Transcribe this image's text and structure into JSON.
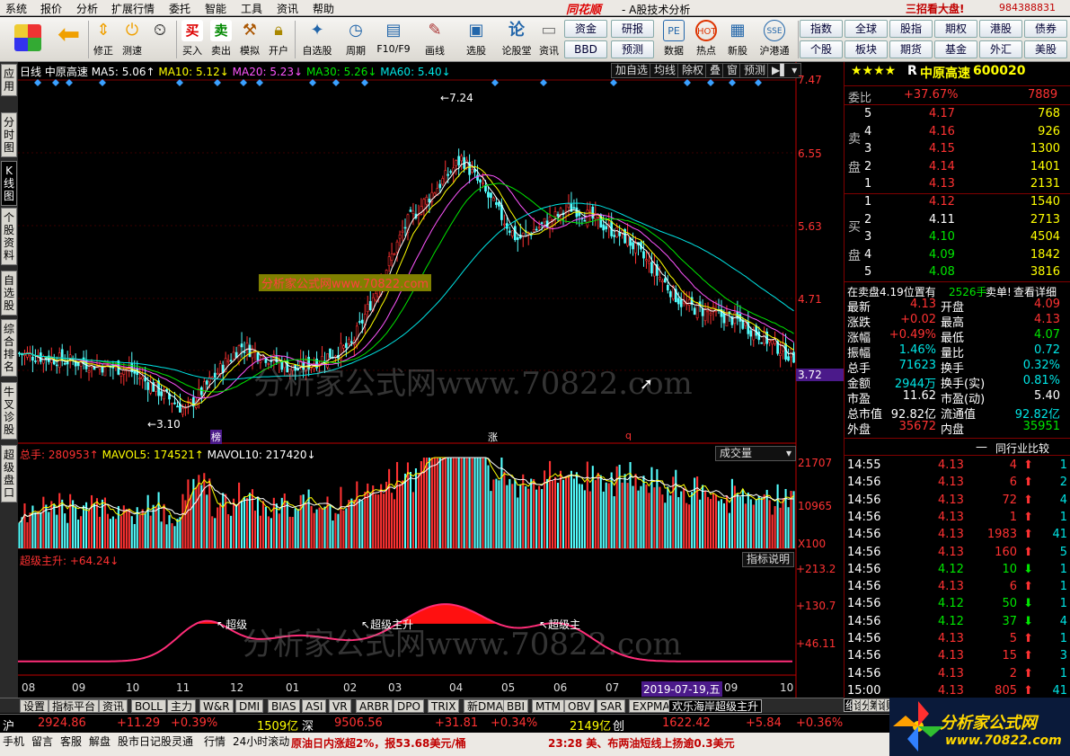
{
  "menu": {
    "items": [
      "系统",
      "报价",
      "分析",
      "扩展行情",
      "委托",
      "智能",
      "工具",
      "资讯",
      "帮助"
    ],
    "brand": "同花顺",
    "subtitle": "- A股技术分析",
    "ad": "三招看大盘!",
    "account": "984388831"
  },
  "toolbar": {
    "buttons": [
      "修正",
      "测速",
      "买入",
      "卖出",
      "模拟",
      "开户",
      "自选股",
      "周期",
      "F10/F9",
      "画线",
      "选股",
      "论股堂",
      "资讯",
      "数据",
      "热点",
      "新股",
      "沪港通"
    ],
    "quick": [
      "资金",
      "研报",
      "BBD",
      "预测",
      "指数",
      "全球",
      "股指",
      "期权",
      "港股",
      "债券",
      "个股",
      "板块",
      "期货",
      "基金",
      "外汇",
      "美股"
    ]
  },
  "lefttabs": [
    "应用",
    "分时图",
    "K线图",
    "个股资料",
    "自选股",
    "综合排名",
    "牛叉诊股",
    "超级盘口"
  ],
  "chart": {
    "price_legend": {
      "period": "日线",
      "name": "中原高速",
      "ma5": "MA5: 5.06↑",
      "ma10": "MA10: 5.12↓",
      "ma20": "MA20: 5.23↓",
      "ma30": "MA30: 5.26↓",
      "ma60": "MA60: 5.40↓"
    },
    "chart_buttons": [
      "加自选",
      "均线",
      "除权",
      "叠",
      "窗",
      "预测"
    ],
    "price_axis": [
      "7.47",
      "6.55",
      "5.63",
      "4.71",
      "3.72"
    ],
    "high_label": "7.24",
    "low_label": "3.10",
    "watermark_small": "分析家公式网www.70822.com",
    "watermark_big": "分析家公式网www.70822.com",
    "marks": [
      "榜",
      "涨",
      "q"
    ],
    "vol_legend": {
      "total": "总手: 280953↑",
      "mavol5": "MAVOL5: 174521↑",
      "mavol10": "MAVOL10: 217420↓"
    },
    "vol_button": "成交量",
    "vol_axis": [
      "21707",
      "10965"
    ],
    "vol_unit": "X100",
    "ind_legend": "超级主升: +64.24↓",
    "ind_button": "指标说明",
    "ind_axis": [
      "+213.2",
      "+130.7",
      "+46.11"
    ],
    "ind_marks": [
      "超级",
      "超级主升",
      "超级主"
    ],
    "x_labels": [
      "08",
      "09",
      "10",
      "11",
      "12",
      "01",
      "02",
      "03",
      "04",
      "05",
      "06",
      "07",
      "08",
      "09",
      "10"
    ],
    "date_label": "2019-07-19,五"
  },
  "chart_data": {
    "type": "candlestick",
    "title": "",
    "xlabel": "",
    "ylabel": "",
    "ylim": [
      3.72,
      7.47
    ],
    "high": 7.24,
    "low": 3.1,
    "x": [
      "08",
      "09",
      "10",
      "11",
      "12",
      "01",
      "02",
      "03",
      "04",
      "05",
      "06",
      "07",
      "08",
      "09",
      "10"
    ],
    "close_approx": [
      4.2,
      4.1,
      4.0,
      3.5,
      4.3,
      4.0,
      4.3,
      5.8,
      6.6,
      5.6,
      6.0,
      5.6,
      4.8,
      4.6,
      4.15
    ]
  },
  "quote": {
    "stars": "★★★★",
    "code_prefix": "R",
    "name": "中原高速",
    "code": "600020",
    "weibi_label": "委比",
    "weibi": "+37.67%",
    "weicha": "7889",
    "sell_label": "卖盘",
    "buy_label": "买盘",
    "sells": [
      {
        "n": "5",
        "p": "4.17",
        "v": "768"
      },
      {
        "n": "4",
        "p": "4.16",
        "v": "926"
      },
      {
        "n": "3",
        "p": "4.15",
        "v": "1300"
      },
      {
        "n": "2",
        "p": "4.14",
        "v": "1401"
      },
      {
        "n": "1",
        "p": "4.13",
        "v": "2131"
      }
    ],
    "buys": [
      {
        "n": "1",
        "p": "4.12",
        "v": "1540"
      },
      {
        "n": "2",
        "p": "4.11",
        "v": "2713"
      },
      {
        "n": "3",
        "p": "4.10",
        "v": "4504"
      },
      {
        "n": "4",
        "p": "4.09",
        "v": "1842"
      },
      {
        "n": "5",
        "p": "4.08",
        "v": "3816"
      }
    ],
    "info_line": "在卖盘4.19位置有",
    "info_vol": "2526手",
    "info_act": "卖单!",
    "info_link": "查看详细",
    "stats": [
      [
        "最新",
        "4.13",
        "开盘",
        "4.09"
      ],
      [
        "涨跌",
        "+0.02",
        "最高",
        "4.13"
      ],
      [
        "涨幅",
        "+0.49%",
        "最低",
        "4.07"
      ],
      [
        "振幅",
        "1.46%",
        "量比",
        "0.72"
      ],
      [
        "总手",
        "71623",
        "换手",
        "0.32%"
      ],
      [
        "金额",
        "2944万",
        "换手(实)",
        "0.81%"
      ],
      [
        "市盈",
        "11.62",
        "市盈(动)",
        "5.40"
      ],
      [
        "总市值",
        "92.82亿",
        "流通值",
        "92.82亿"
      ],
      [
        "外盘",
        "35672",
        "内盘",
        "35951"
      ]
    ],
    "compare": "同行业比较",
    "ticks": [
      [
        "14:55",
        "4.13",
        "4",
        "up",
        "1"
      ],
      [
        "14:56",
        "4.13",
        "6",
        "up",
        "2"
      ],
      [
        "14:56",
        "4.13",
        "72",
        "up",
        "4"
      ],
      [
        "14:56",
        "4.13",
        "1",
        "up",
        "1"
      ],
      [
        "14:56",
        "4.13",
        "1983",
        "up",
        "41"
      ],
      [
        "14:56",
        "4.13",
        "160",
        "up",
        "5"
      ],
      [
        "14:56",
        "4.12",
        "10",
        "dn",
        "1"
      ],
      [
        "14:56",
        "4.13",
        "6",
        "up",
        "1"
      ],
      [
        "14:56",
        "4.12",
        "50",
        "dn",
        "1"
      ],
      [
        "14:56",
        "4.12",
        "37",
        "dn",
        "4"
      ],
      [
        "14:56",
        "4.13",
        "5",
        "up",
        "1"
      ],
      [
        "14:56",
        "4.13",
        "15",
        "up",
        "3"
      ],
      [
        "14:56",
        "4.13",
        "2",
        "up",
        "1"
      ],
      [
        "15:00",
        "4.13",
        "805",
        "up",
        "41"
      ]
    ]
  },
  "bottom_tabs": [
    "设置",
    "指标平台",
    "资讯",
    "BOLL",
    "主力",
    "W&R",
    "DMI",
    "BIAS",
    "ASI",
    "VR",
    "ARBR",
    "DPO",
    "TRIX",
    "新DMA",
    "BBI",
    "MTM",
    "OBV",
    "SAR",
    "EXPMA",
    "欢乐海岸超级主升"
  ],
  "right_tabs": [
    "细",
    "诊",
    "分",
    "筹",
    "论",
    "财"
  ],
  "index": {
    "sh_label": "沪",
    "sh": "2924.86",
    "sh_chg": "+11.29",
    "sh_pct": "+0.39%",
    "sh_amt": "1509亿",
    "sz_label": "深",
    "sz": "9506.56",
    "sz_chg": "+31.81",
    "sz_pct": "+0.34%",
    "sz_amt": "2149亿",
    "cy_label": "创",
    "cy": "1622.42",
    "cy_chg": "+5.84",
    "cy_pct": "+0.36%"
  },
  "status": {
    "items": [
      "手机",
      "留言",
      "客服",
      "解盘",
      "股市日记",
      "股灵通",
      "行情",
      "24小时滚动"
    ],
    "news1": "原油日内涨超2%，报53.68美元/桶",
    "news2": "23:28 美、布两油短线上扬逾0.3美元"
  },
  "logo": {
    "text": "分析家公式网",
    "url": "www.70822.com"
  }
}
